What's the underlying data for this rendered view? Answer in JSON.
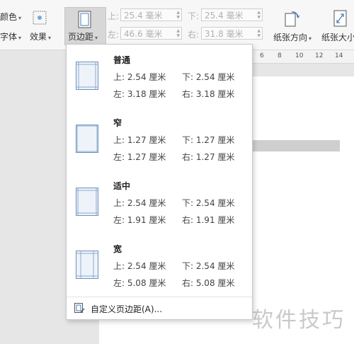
{
  "ribbon": {
    "color_label": "颜色",
    "font_label": "字体",
    "effects_label": "效果",
    "margins_label": "页边距",
    "top_label": "上:",
    "top_value": "25.4 毫米",
    "left_label": "左:",
    "left_value": "46.6 毫米",
    "bottom_label": "下:",
    "bottom_value": "25.4 毫米",
    "right_label": "右:",
    "right_value": "31.8 毫米",
    "orientation_label": "纸张方向",
    "paper_size_label": "纸张大小"
  },
  "ruler": {
    "ticks": [
      "6",
      "8",
      "10",
      "12",
      "14"
    ]
  },
  "margins_menu": {
    "options": [
      {
        "name": "普通",
        "top": "上: 2.54 厘米",
        "bottom": "下: 2.54 厘米",
        "left": "左: 3.18 厘米",
        "right": "右: 3.18 厘米"
      },
      {
        "name": "窄",
        "top": "上: 1.27 厘米",
        "bottom": "下: 1.27 厘米",
        "left": "左: 1.27 厘米",
        "right": "右: 1.27 厘米"
      },
      {
        "name": "适中",
        "top": "上: 2.54 厘米",
        "bottom": "下: 2.54 厘米",
        "left": "左: 1.91 厘米",
        "right": "右: 1.91 厘米"
      },
      {
        "name": "宽",
        "top": "上: 2.54 厘米",
        "bottom": "下: 2.54 厘米",
        "left": "左: 5.08 厘米",
        "right": "右: 5.08 厘米"
      }
    ],
    "custom_label": "自定义页边距(A)..."
  },
  "watermark": "软件技巧"
}
